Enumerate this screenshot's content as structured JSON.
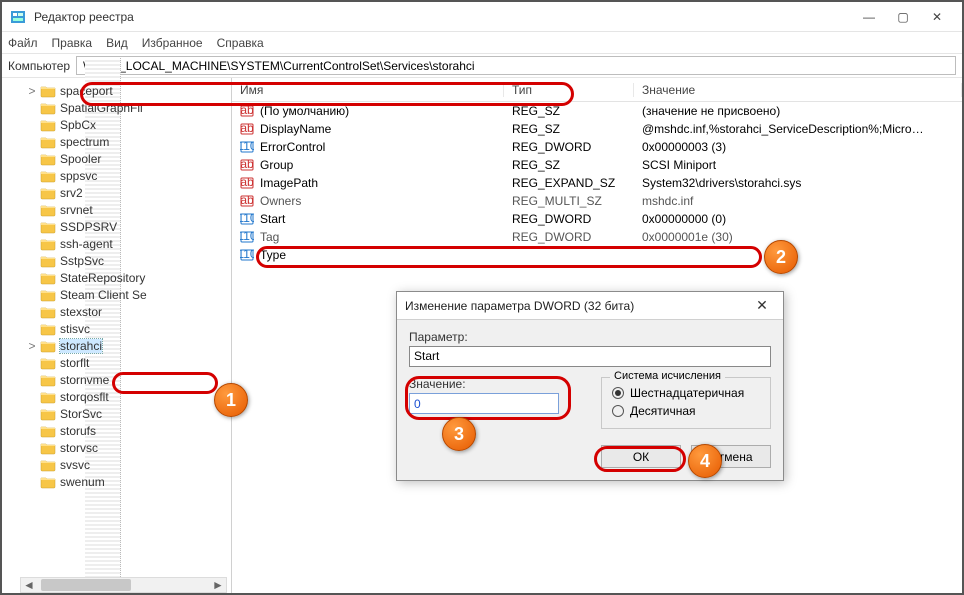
{
  "window": {
    "title": "Редактор реестра",
    "min": "—",
    "max": "▢",
    "close": "✕"
  },
  "menu": [
    "Файл",
    "Правка",
    "Вид",
    "Избранное",
    "Справка"
  ],
  "pathbar": {
    "label": "Компьютер",
    "path": "\\HKEY_LOCAL_MACHINE\\SYSTEM\\CurrentControlSet\\Services\\storahci"
  },
  "tree": {
    "items": [
      {
        "label": "spaceport",
        "expander": ">"
      },
      {
        "label": "SpatialGraphFil"
      },
      {
        "label": "SpbCx"
      },
      {
        "label": "spectrum"
      },
      {
        "label": "Spooler"
      },
      {
        "label": "sppsvc"
      },
      {
        "label": "srv2"
      },
      {
        "label": "srvnet"
      },
      {
        "label": "SSDPSRV"
      },
      {
        "label": "ssh-agent"
      },
      {
        "label": "SstpSvc"
      },
      {
        "label": "StateRepository"
      },
      {
        "label": "Steam Client Se"
      },
      {
        "label": "stexstor"
      },
      {
        "label": "stisvc"
      },
      {
        "label": "storahci",
        "expander": ">",
        "selected": true
      },
      {
        "label": "storflt"
      },
      {
        "label": "stornvme"
      },
      {
        "label": "storqosflt"
      },
      {
        "label": "StorSvc"
      },
      {
        "label": "storufs"
      },
      {
        "label": "storvsc"
      },
      {
        "label": "svsvc"
      },
      {
        "label": "swenum"
      }
    ]
  },
  "list": {
    "headers": {
      "name": "Имя",
      "type": "Тип",
      "value": "Значение"
    },
    "rows": [
      {
        "icon": "str",
        "name": "(По умолчанию)",
        "type": "REG_SZ",
        "value": "(значение не присвоено)"
      },
      {
        "icon": "str",
        "name": "DisplayName",
        "type": "REG_SZ",
        "value": "@mshdc.inf,%storahci_ServiceDescription%;Micro…"
      },
      {
        "icon": "bin",
        "name": "ErrorControl",
        "type": "REG_DWORD",
        "value": "0x00000003 (3)"
      },
      {
        "icon": "str",
        "name": "Group",
        "type": "REG_SZ",
        "value": "SCSI Miniport"
      },
      {
        "icon": "str",
        "name": "ImagePath",
        "type": "REG_EXPAND_SZ",
        "value": "System32\\drivers\\storahci.sys"
      },
      {
        "icon": "str",
        "name": "Owners",
        "type": "REG_MULTI_SZ",
        "value": "mshdc.inf",
        "muted": true
      },
      {
        "icon": "bin",
        "name": "Start",
        "type": "REG_DWORD",
        "value": "0x00000000 (0)"
      },
      {
        "icon": "bin",
        "name": "Tag",
        "type": "REG_DWORD",
        "value": "0x0000001e (30)",
        "muted": true
      },
      {
        "icon": "bin",
        "name": "Type",
        "type": "",
        "value": ""
      }
    ]
  },
  "dialog": {
    "title": "Изменение параметра DWORD (32 бита)",
    "param_label": "Параметр:",
    "param_value": "Start",
    "value_label": "Значение:",
    "value_input": "0",
    "radix_legend": "Система исчисления",
    "radix_hex": "Шестнадцатеричная",
    "radix_dec": "Десятичная",
    "ok": "ОК",
    "cancel": "Отмена"
  },
  "badges": {
    "b1": "1",
    "b2": "2",
    "b3": "3",
    "b4": "4"
  }
}
